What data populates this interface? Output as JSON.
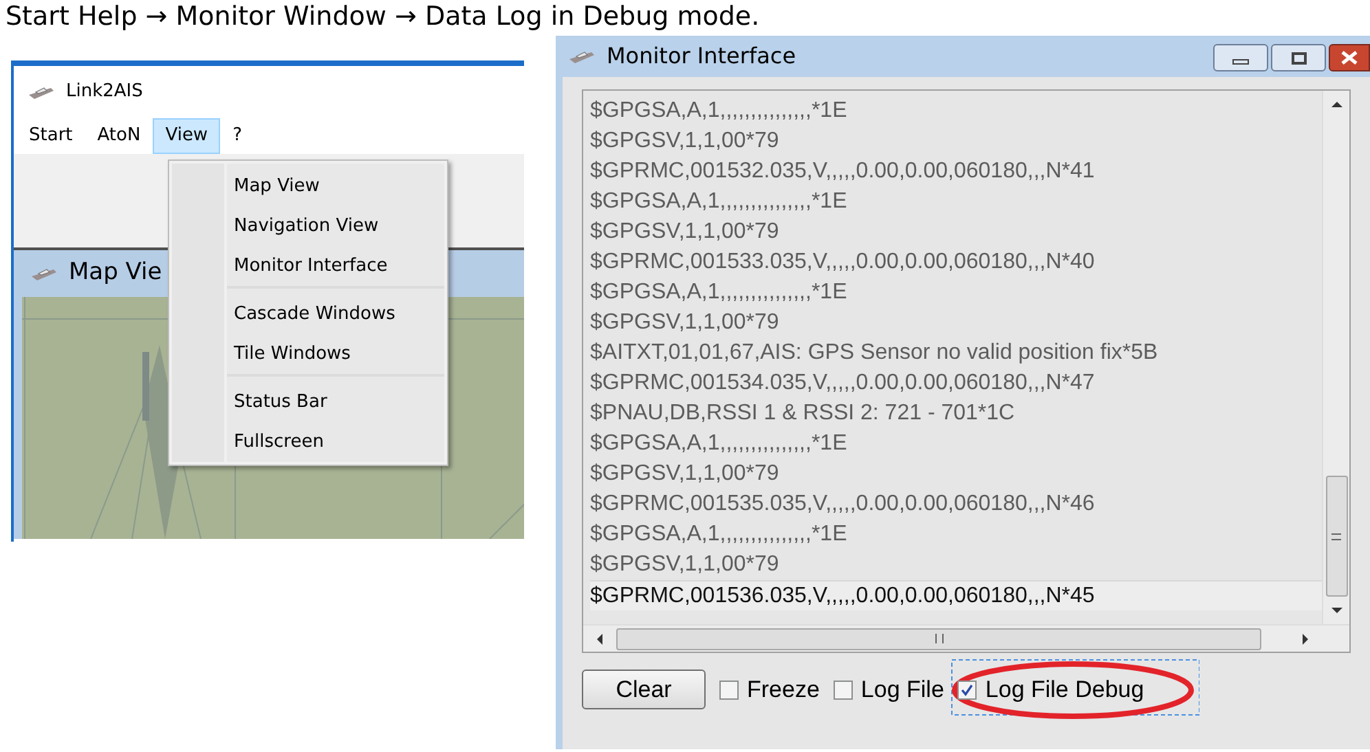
{
  "heading": "Start Help → Monitor Window → Data Log in Debug mode.",
  "app_window": {
    "title": "Link2AIS",
    "menu_bar": [
      {
        "label": "Start",
        "selected": false
      },
      {
        "label": "AtoN",
        "selected": false
      },
      {
        "label": "View",
        "selected": true
      },
      {
        "label": "?",
        "selected": false
      }
    ],
    "child_window": {
      "title": "Map Vie"
    },
    "view_menu": {
      "groups": [
        [
          "Map View",
          "Navigation View",
          "Monitor Interface"
        ],
        [
          "Cascade Windows",
          "Tile Windows"
        ],
        [
          "Status Bar",
          "Fullscreen"
        ]
      ]
    }
  },
  "monitor_window": {
    "title": "Monitor Interface",
    "lines": [
      {
        "text": "$GPGSA,A,1,,,,,,,,,,,,,,,*1E",
        "selected": false
      },
      {
        "text": "$GPGSV,1,1,00*79",
        "selected": false
      },
      {
        "text": "$GPRMC,001532.035,V,,,,,0.00,0.00,060180,,,N*41",
        "selected": false
      },
      {
        "text": "$GPGSA,A,1,,,,,,,,,,,,,,,*1E",
        "selected": false
      },
      {
        "text": "$GPGSV,1,1,00*79",
        "selected": false
      },
      {
        "text": "$GPRMC,001533.035,V,,,,,0.00,0.00,060180,,,N*40",
        "selected": false
      },
      {
        "text": "$GPGSA,A,1,,,,,,,,,,,,,,,*1E",
        "selected": false
      },
      {
        "text": "$GPGSV,1,1,00*79",
        "selected": false
      },
      {
        "text": "$AITXT,01,01,67,AIS: GPS Sensor no valid position fix*5B",
        "selected": false
      },
      {
        "text": "$GPRMC,001534.035,V,,,,,0.00,0.00,060180,,,N*47",
        "selected": false
      },
      {
        "text": "$PNAU,DB,RSSI 1 & RSSI 2: 721 - 701*1C",
        "selected": false
      },
      {
        "text": "$GPGSA,A,1,,,,,,,,,,,,,,,*1E",
        "selected": false
      },
      {
        "text": "$GPGSV,1,1,00*79",
        "selected": false
      },
      {
        "text": "$GPRMC,001535.035,V,,,,,0.00,0.00,060180,,,N*46",
        "selected": false
      },
      {
        "text": "$GPGSA,A,1,,,,,,,,,,,,,,,*1E",
        "selected": false
      },
      {
        "text": "$GPGSV,1,1,00*79",
        "selected": false
      },
      {
        "text": "$GPRMC,001536.035,V,,,,,0.00,0.00,060180,,,N*45",
        "selected": true
      }
    ],
    "clear_button": "Clear",
    "options": [
      {
        "label": "Freeze",
        "checked": false,
        "highlighted": false
      },
      {
        "label": "Log File",
        "checked": false,
        "highlighted": false
      },
      {
        "label": "Log File Debug",
        "checked": true,
        "highlighted": true
      }
    ]
  }
}
